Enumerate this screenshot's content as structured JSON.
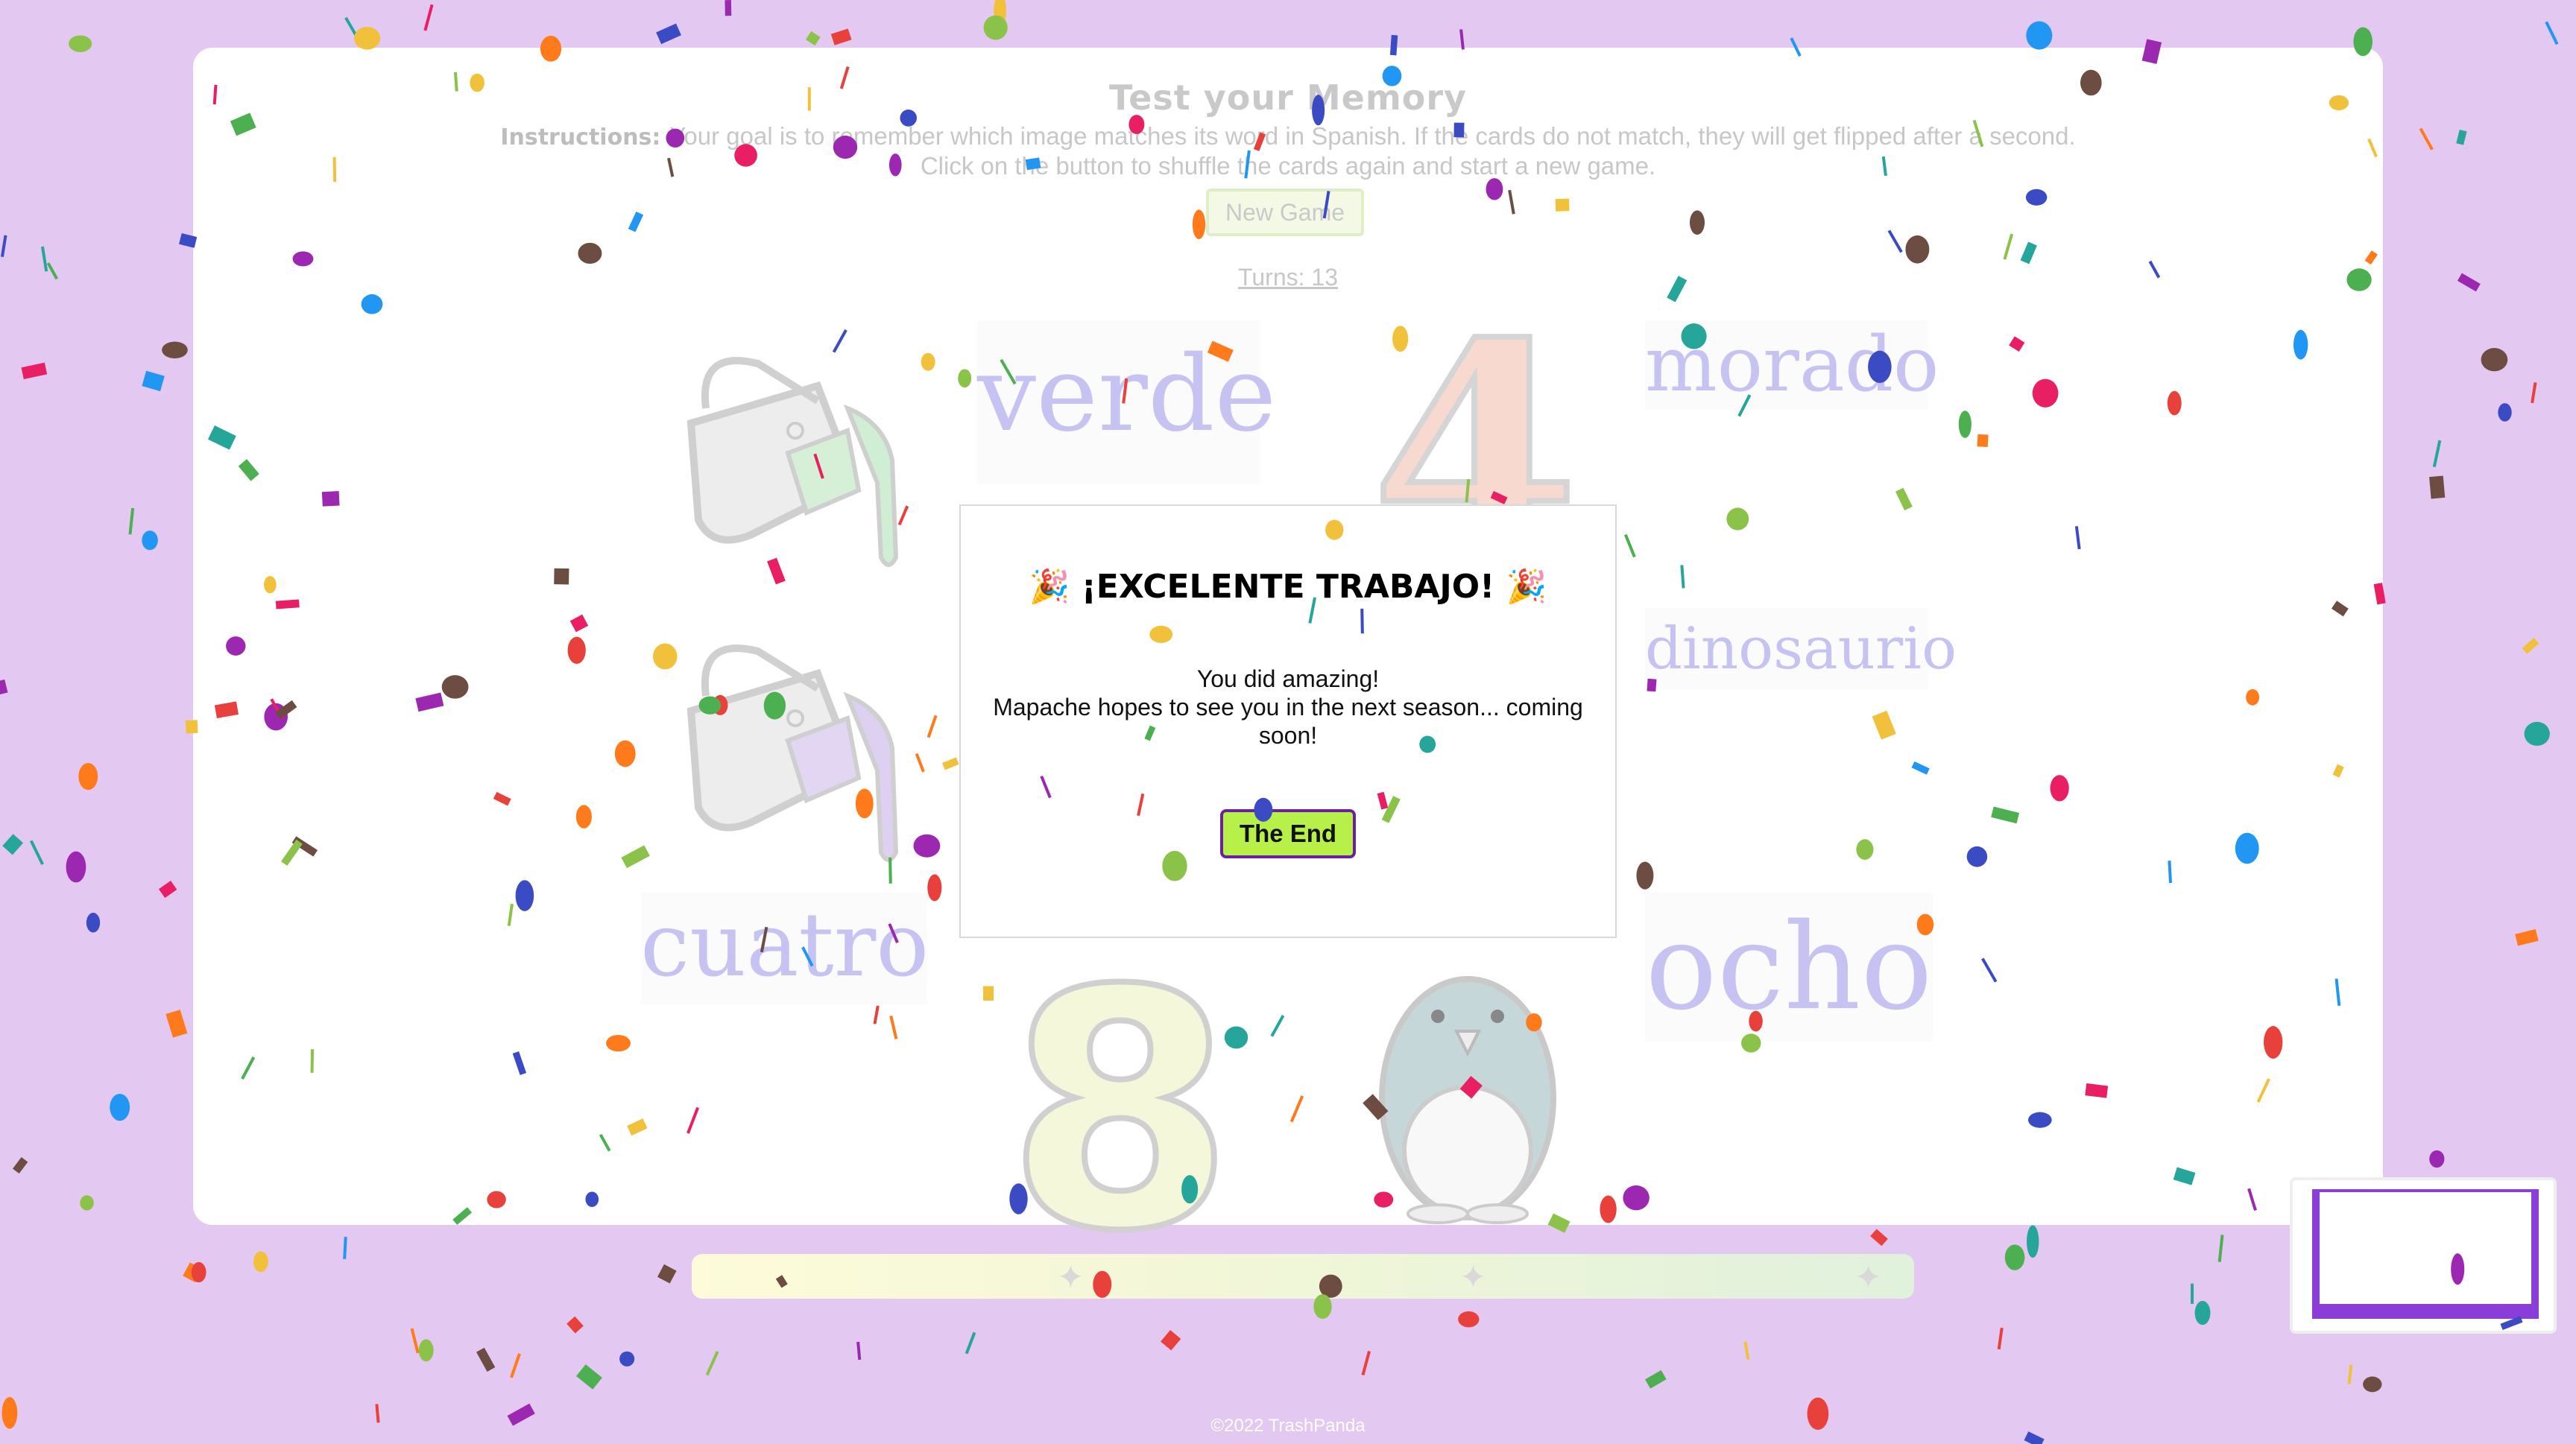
{
  "game": {
    "title": "Test your Memory",
    "instructions_label": "Instructions:",
    "instructions_line1": "Your goal is to remember which image matches its word in Spanish. If the cards do not match, they will get flipped after a second.",
    "instructions_line2": "Click on the button to shuffle the cards again and start a new game.",
    "new_game_label": "New Game",
    "turns_label": "Turns: 13"
  },
  "cards": {
    "verde": "verde",
    "morado": "morado",
    "dinosaurio": "dinosaurio",
    "cuatro": "cuatro",
    "ocho": "ocho",
    "number_four": "4",
    "number_eight": "8"
  },
  "modal": {
    "title": "¡EXCELENTE TRABAJO!",
    "party_icon": "party-popper-icon",
    "line1": "You did amazing!",
    "line2": "Mapache hopes to see you in the next season... coming soon!",
    "button_label": "The End"
  },
  "progress": {
    "value": 1.0
  },
  "footer": {
    "copyright": "©2022 TrashPanda"
  },
  "colors": {
    "background": "#e3c8f1",
    "word": "#c6c3f3",
    "button_green": "#b8f04a",
    "button_border": "#6d1fa2",
    "minimap_frame": "#8b3dd8"
  }
}
